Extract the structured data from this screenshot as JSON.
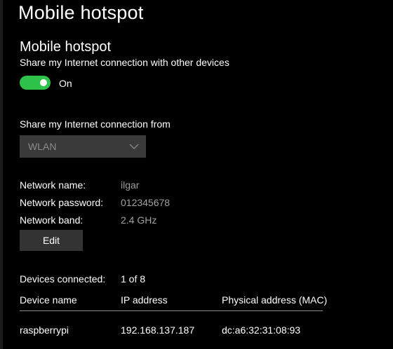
{
  "page": {
    "title": "Mobile hotspot"
  },
  "hotspot": {
    "section_title": "Mobile hotspot",
    "share_description": "Share my Internet connection with other devices",
    "toggle_state": "On",
    "toggle_on": true,
    "accent_color": "#2ec24a"
  },
  "connection_source": {
    "label": "Share my Internet connection from",
    "selected": "WLAN",
    "chevron_icon": "chevron-down-icon"
  },
  "network": {
    "name_label": "Network name:",
    "name_value": "ilgar",
    "password_label": "Network password:",
    "password_value": "012345678",
    "band_label": "Network band:",
    "band_value": "2.4 GHz",
    "edit_label": "Edit"
  },
  "devices": {
    "connected_label": "Devices connected:",
    "connected_count": "1 of 8",
    "columns": [
      "Device name",
      "IP address",
      "Physical address (MAC)"
    ],
    "rows": [
      {
        "name": "raspberrypi",
        "ip": "192.168.137.187",
        "mac": "dc:a6:32:31:08:93"
      }
    ]
  }
}
